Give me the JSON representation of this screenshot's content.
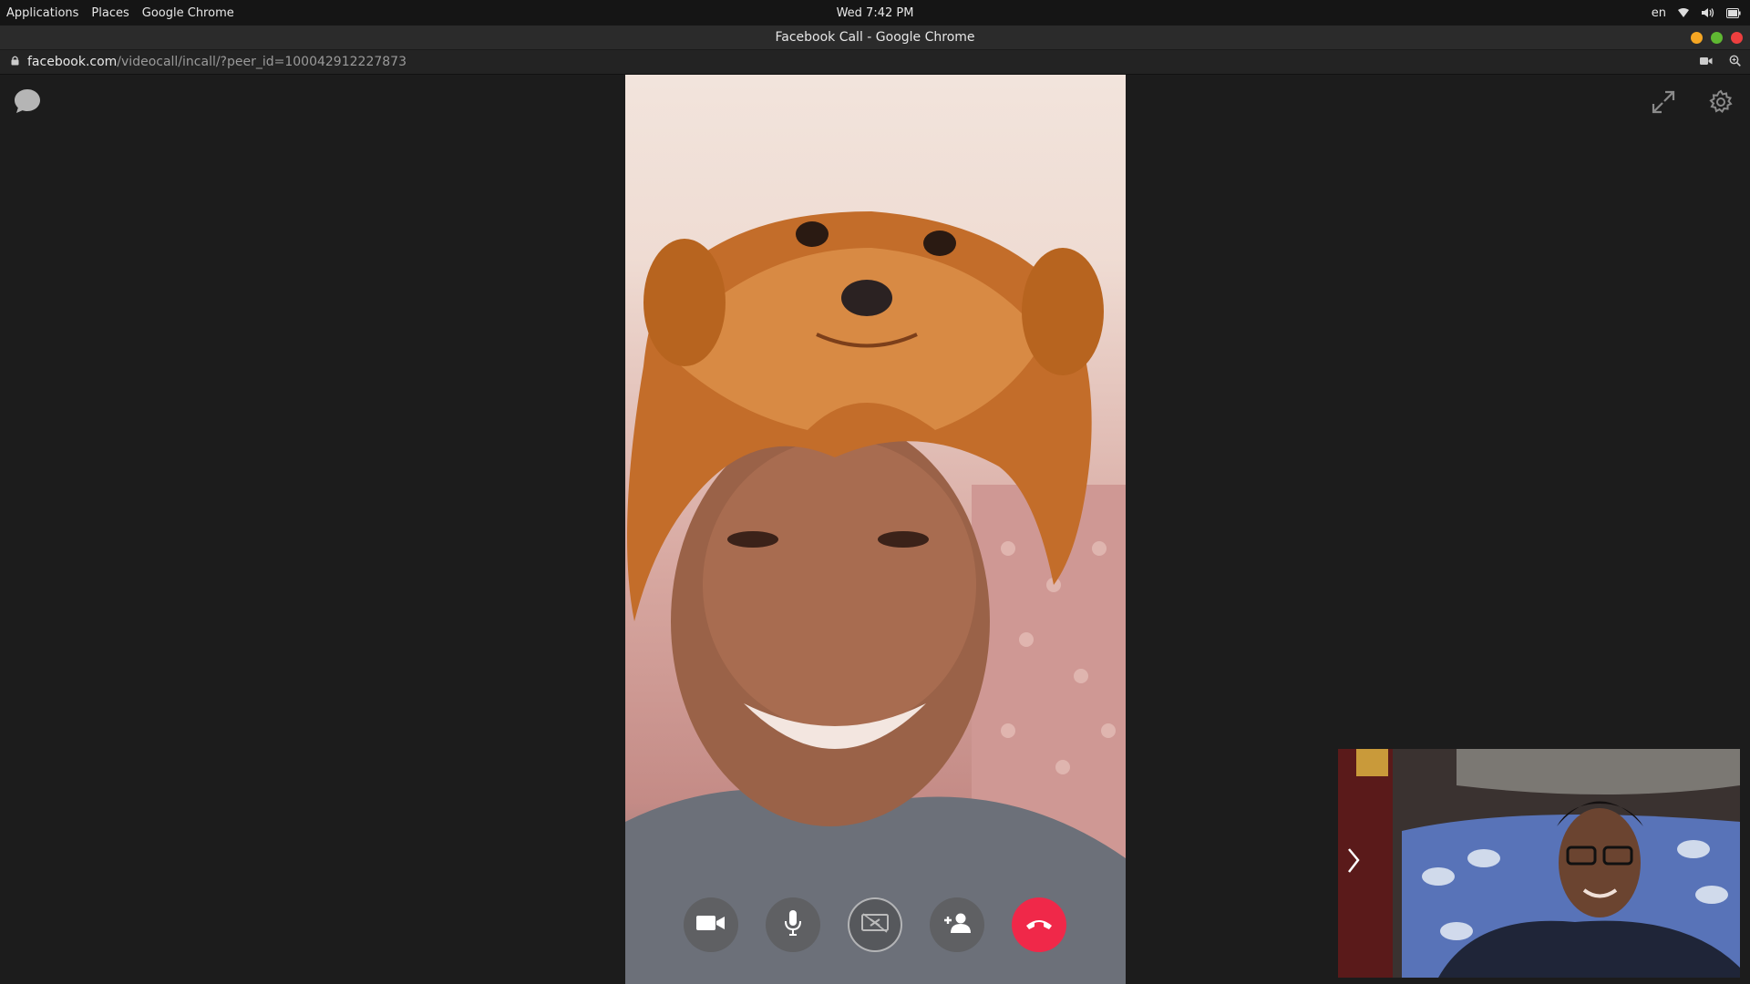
{
  "topbar": {
    "menu": [
      "Applications",
      "Places",
      "Google Chrome"
    ],
    "clock": "Wed 7:42 PM",
    "lang": "en"
  },
  "window": {
    "title": "Facebook Call - Google Chrome"
  },
  "urlbar": {
    "host": "facebook.com",
    "path": "/videocall/incall/?peer_id=100042912227873"
  },
  "call": {
    "controls": [
      {
        "name": "camera-toggle",
        "icon": "video-camera-icon"
      },
      {
        "name": "mic-toggle",
        "icon": "microphone-icon"
      },
      {
        "name": "screen-share",
        "icon": "screen-share-off-icon"
      },
      {
        "name": "add-person",
        "icon": "add-person-icon"
      },
      {
        "name": "end-call",
        "icon": "hang-up-icon"
      }
    ]
  },
  "colors": {
    "end_call": "#f02849",
    "background": "#1c1c1c",
    "wm_minimize": "#f5a623",
    "wm_maximize": "#5fb832",
    "wm_close": "#ed3f3f"
  }
}
